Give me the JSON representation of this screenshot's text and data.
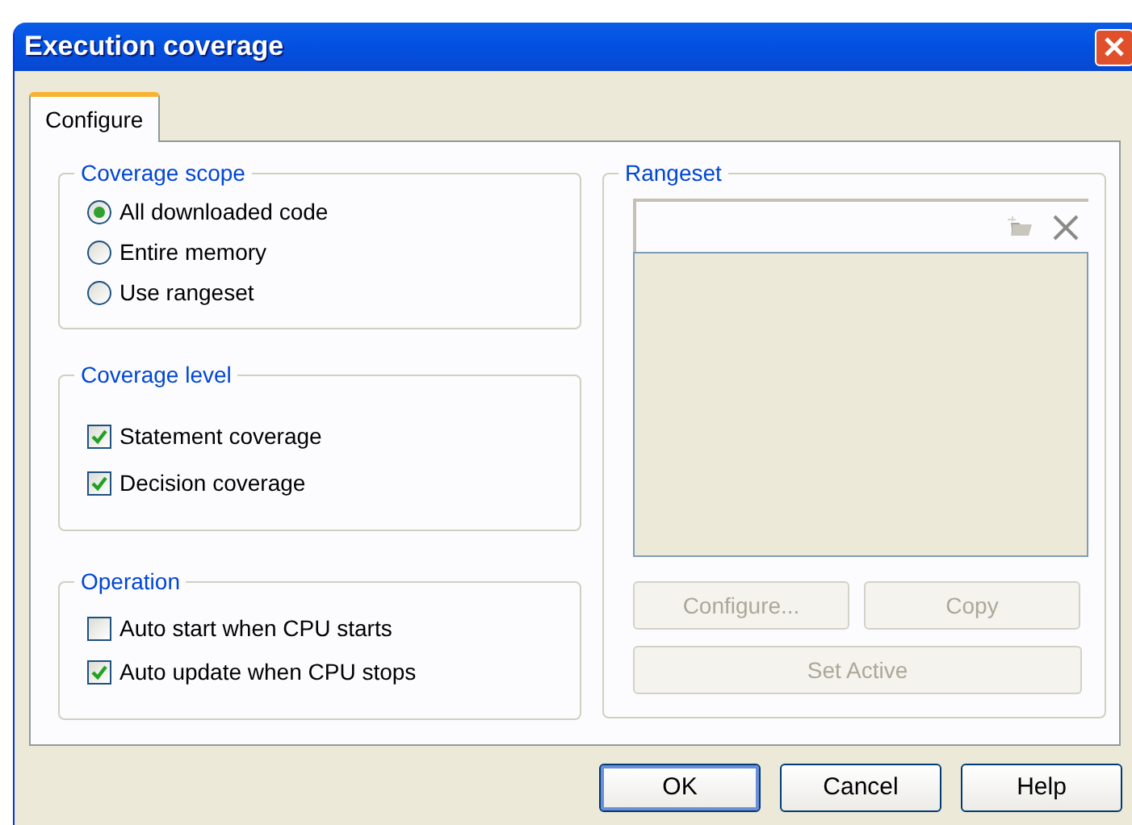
{
  "window": {
    "title": "Execution coverage"
  },
  "tabs": [
    {
      "label": "Configure",
      "selected": true
    }
  ],
  "coverage_scope": {
    "title": "Coverage scope",
    "options": [
      {
        "label": "All downloaded code",
        "selected": true
      },
      {
        "label": "Entire memory",
        "selected": false
      },
      {
        "label": "Use rangeset",
        "selected": false
      }
    ]
  },
  "coverage_level": {
    "title": "Coverage level",
    "options": [
      {
        "label": "Statement coverage",
        "checked": true
      },
      {
        "label": "Decision coverage",
        "checked": true
      }
    ]
  },
  "operation": {
    "title": "Operation",
    "options": [
      {
        "label": "Auto start when CPU starts",
        "checked": false
      },
      {
        "label": "Auto update when CPU stops",
        "checked": true
      }
    ]
  },
  "rangeset": {
    "title": "Rangeset",
    "buttons": [
      {
        "label": "Configure...",
        "disabled": true
      },
      {
        "label": "Copy",
        "disabled": true
      },
      {
        "label": "Set Active",
        "disabled": true
      }
    ]
  },
  "buttons": [
    {
      "label": "OK",
      "default": true
    },
    {
      "label": "Cancel",
      "default": false
    },
    {
      "label": "Help",
      "default": false
    }
  ]
}
